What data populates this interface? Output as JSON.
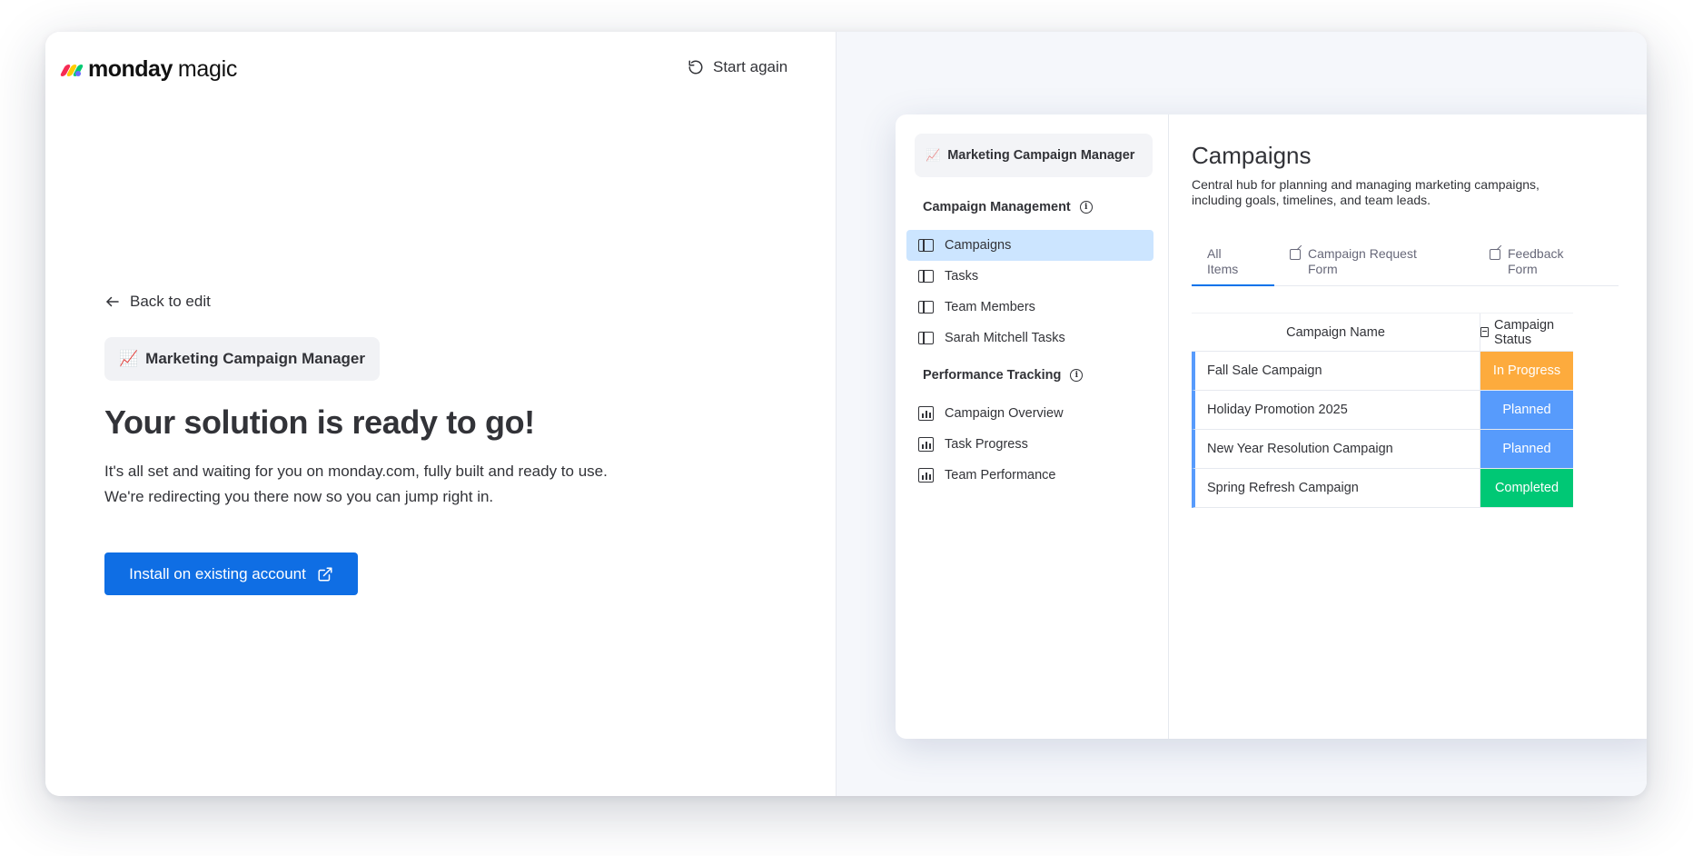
{
  "logo": {
    "word": "monday",
    "suffix": "magic"
  },
  "header": {
    "start_again": "Start again"
  },
  "back": {
    "label": "Back to edit"
  },
  "app_chip": {
    "emoji": "📈",
    "name": "Marketing Campaign Manager"
  },
  "headline": "Your solution is ready to go!",
  "description": "It's all set and waiting for you on monday.com, fully built and ready to use. We're redirecting you there now so you can jump right in.",
  "install_button": {
    "label": "Install on existing account"
  },
  "preview": {
    "app": {
      "emoji": "📈",
      "name": "Marketing Campaign Manager"
    },
    "groups": [
      {
        "title": "Campaign Management",
        "items": [
          "Campaigns",
          "Tasks",
          "Team Members",
          "Sarah Mitchell Tasks"
        ]
      },
      {
        "title": "Performance Tracking",
        "items": [
          "Campaign Overview",
          "Task Progress",
          "Team Performance"
        ]
      }
    ],
    "board": {
      "title": "Campaigns",
      "description": "Central hub for planning and managing marketing campaigns, including goals, timelines, and team leads.",
      "tabs": [
        "All Items",
        "Campaign Request Form",
        "Feedback Form"
      ],
      "columns": [
        "Campaign Name",
        "Campaign Status"
      ],
      "rows": [
        {
          "name": "Fall Sale Campaign",
          "status": "In Progress",
          "color": "#fdab3d"
        },
        {
          "name": "Holiday Promotion 2025",
          "status": "Planned",
          "color": "#579bfc"
        },
        {
          "name": "New Year Resolution Campaign",
          "status": "Planned",
          "color": "#579bfc"
        },
        {
          "name": "Spring Refresh Campaign",
          "status": "Completed",
          "color": "#00c875"
        }
      ]
    }
  },
  "colors": {
    "primary": "#0f6ee4",
    "active_nav": "#cce5ff",
    "in_progress": "#fdab3d",
    "planned": "#579bfc",
    "completed": "#00c875"
  }
}
